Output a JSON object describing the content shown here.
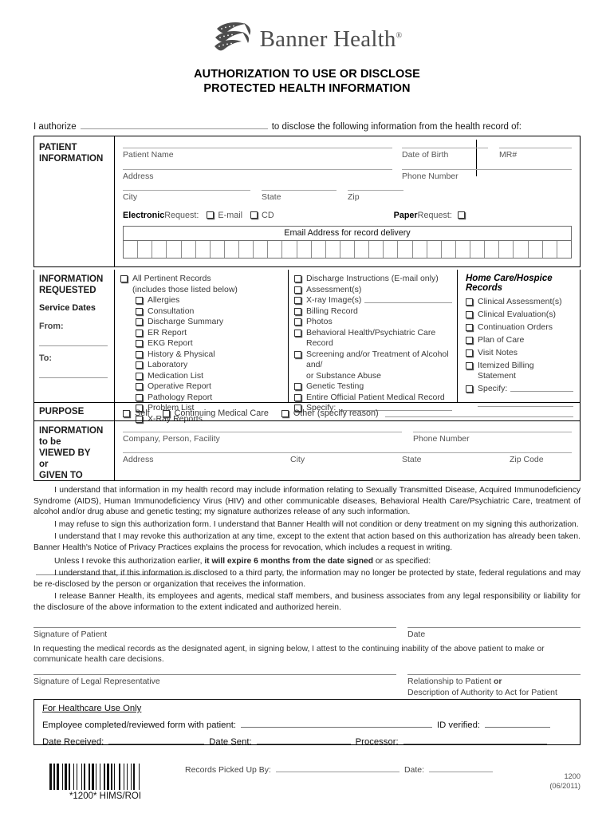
{
  "header": {
    "logo_text": "Banner Health",
    "logo_reg": "®",
    "title_line1": "AUTHORIZATION TO USE OR DISCLOSE",
    "title_line2": "PROTECTED HEALTH INFORMATION"
  },
  "authorize": {
    "prefix": "I authorize",
    "suffix": "to disclose the following information from the health record of:"
  },
  "patient_information": {
    "section_label_line1": "PATIENT",
    "section_label_line2": "INFORMATION",
    "fields": {
      "patient_name": "Patient Name",
      "date_of_birth": "Date of Birth",
      "mr_number": "MR#",
      "address": "Address",
      "phone_number": "Phone Number",
      "city": "City",
      "state": "State",
      "zip": "Zip"
    },
    "request_row": {
      "electronic_bold": "Electronic",
      "electronic_rest": " Request:",
      "email_option": "E-mail",
      "cd_option": "CD",
      "paper_bold": "Paper",
      "paper_rest": " Request:"
    },
    "email_grid": {
      "header": "Email Address for record delivery",
      "cell_count": 31
    }
  },
  "information_requested": {
    "section_label_line1": "INFORMATION",
    "section_label_line2": "REQUESTED",
    "service_dates_label": "Service Dates",
    "from_label": "From:",
    "to_label": "To:",
    "column_one": {
      "all_pertinent": "All Pertinent Records",
      "all_pertinent_sub": "(includes those listed below)",
      "items": [
        "Allergies",
        "Consultation",
        "Discharge Summary",
        "ER Report",
        "EKG Report",
        "History & Physical",
        "Laboratory",
        "Medication List",
        "Operative Report",
        "Pathology Report",
        "Problem List",
        "X-Ray Reports"
      ]
    },
    "column_two": {
      "items": [
        "Discharge Instructions (E-mail only)",
        "Assessment(s)",
        "X-ray Image(s)",
        "Billing Record",
        "Photos",
        "Behavioral Health/Psychiatric Care Record"
      ],
      "alcohol_line1": "Screening and/or Treatment of Alcohol and/",
      "alcohol_line2": "or Substance Abuse",
      "items_after": [
        "Genetic Testing",
        "Entire Official Patient Medical Record"
      ],
      "specify": "Specify:"
    },
    "column_three": {
      "title": "Home Care/Hospice Records",
      "items": [
        "Clinical Assessment(s)",
        "Clinical Evaluation(s)",
        "Continuation Orders",
        "Plan of Care",
        "Visit Notes",
        "Itemized Billing Statement"
      ],
      "specify": "Specify:"
    }
  },
  "purpose": {
    "section_label": "PURPOSE",
    "options": [
      "Self",
      "Continuing Medical Care",
      "Other (specify reason)"
    ]
  },
  "viewed_by": {
    "section_label_lines": [
      "INFORMATION",
      "to be",
      "VIEWED BY",
      "or",
      "GIVEN TO"
    ],
    "fields": {
      "company": "Company, Person, Facility",
      "phone_number": "Phone Number",
      "address": "Address",
      "city": "City",
      "state": "State",
      "zip_code": "Zip Code"
    }
  },
  "body_paragraphs": [
    "I understand that information in my health record may include information relating to Sexually Transmitted Disease, Acquired Immunodeficiency Syndrome (AIDS), Human Immunodeficiency Virus (HIV) and other communicable diseases, Behavioral Health Care/Psychiatric Care, treatment of alcohol and/or drug abuse and genetic testing; my signature authorizes release of any such information.",
    "I may refuse to sign this authorization form. I understand that Banner Health will not condition or deny treatment on my signing this authorization.",
    "I understand that I may revoke this authorization at any time, except to the extent that action based on this authorization has already been taken. Banner Health's Notice of Privacy Practices explains the process for revocation, which includes a request in writing."
  ],
  "expire_paragraph": {
    "lead": "Unless I revoke this authorization earlier,",
    "bold": "it will expire 6 months from the date signed",
    "tail": "or as specified:"
  },
  "body_paragraphs_2": [
    "I understand that, if this information is disclosed to a third party, the information may no longer be protected by state, federal regulations and may be re-disclosed by the person or organization that receives the information.",
    "I release Banner Health, its employees and agents, medical staff members, and business associates from any legal responsibility or liability for the disclosure of the above information to the extent indicated and authorized herein."
  ],
  "signatures": {
    "patient_caption": "Signature of Patient",
    "date_caption": "Date",
    "attestation": "In requesting the medical records as the designated agent, in signing below, I attest to the continuing inability of the above patient to make or communicate health care decisions.",
    "legal_rep_caption": "Signature of Legal Representative",
    "relationship_caption_line1_lead": "Relationship to Patient ",
    "relationship_caption_line1_bold": "or",
    "relationship_caption_line2": "Description of Authority to Act for Patient"
  },
  "healthcare_use": {
    "title": "For Healthcare Use Only",
    "employee_label": "Employee completed/reviewed form with patient:",
    "id_verified_label": "ID verified:",
    "date_received_label": "Date Received:",
    "date_sent_label": "Date Sent:",
    "processor_label": "Processor:"
  },
  "footer": {
    "barcode_caption": "*1200* HIMS/ROI",
    "records_picked_up_label": "Records Picked Up By:",
    "date_label": "Date:",
    "form_number": "1200",
    "form_revision": "(06/2011)"
  }
}
